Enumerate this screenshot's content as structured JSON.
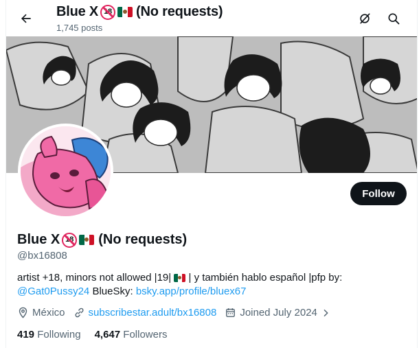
{
  "header": {
    "title_name": "Blue X",
    "title_suffix": "(No requests)",
    "posts_count": "1,745 posts",
    "icons": [
      "back-arrow-icon",
      "grok-icon",
      "search-icon"
    ]
  },
  "badge": {
    "text": "18"
  },
  "profile": {
    "name": "Blue X",
    "name_suffix": "(No requests)",
    "handle": "@bx16808",
    "follow_label": "Follow",
    "bio_part1": "artist +18, minors not allowed |19|",
    "bio_part2": "| y también hablo español |pfp by:",
    "bio_mention": "@Gat0Pussy24",
    "bio_bluesky_label": " BlueSky: ",
    "bio_bluesky_link": "bsky.app/profile/bluex67",
    "location": "México",
    "website": "subscribestar.adult/bx16808",
    "joined": "Joined July 2024",
    "following_count": "419",
    "following_label": "Following",
    "followers_count": "4,647",
    "followers_label": "Followers"
  },
  "colors": {
    "accent": "#1d9bf0",
    "text": "#0f1419",
    "secondary": "#536471",
    "follow_bg": "#0f1419"
  }
}
